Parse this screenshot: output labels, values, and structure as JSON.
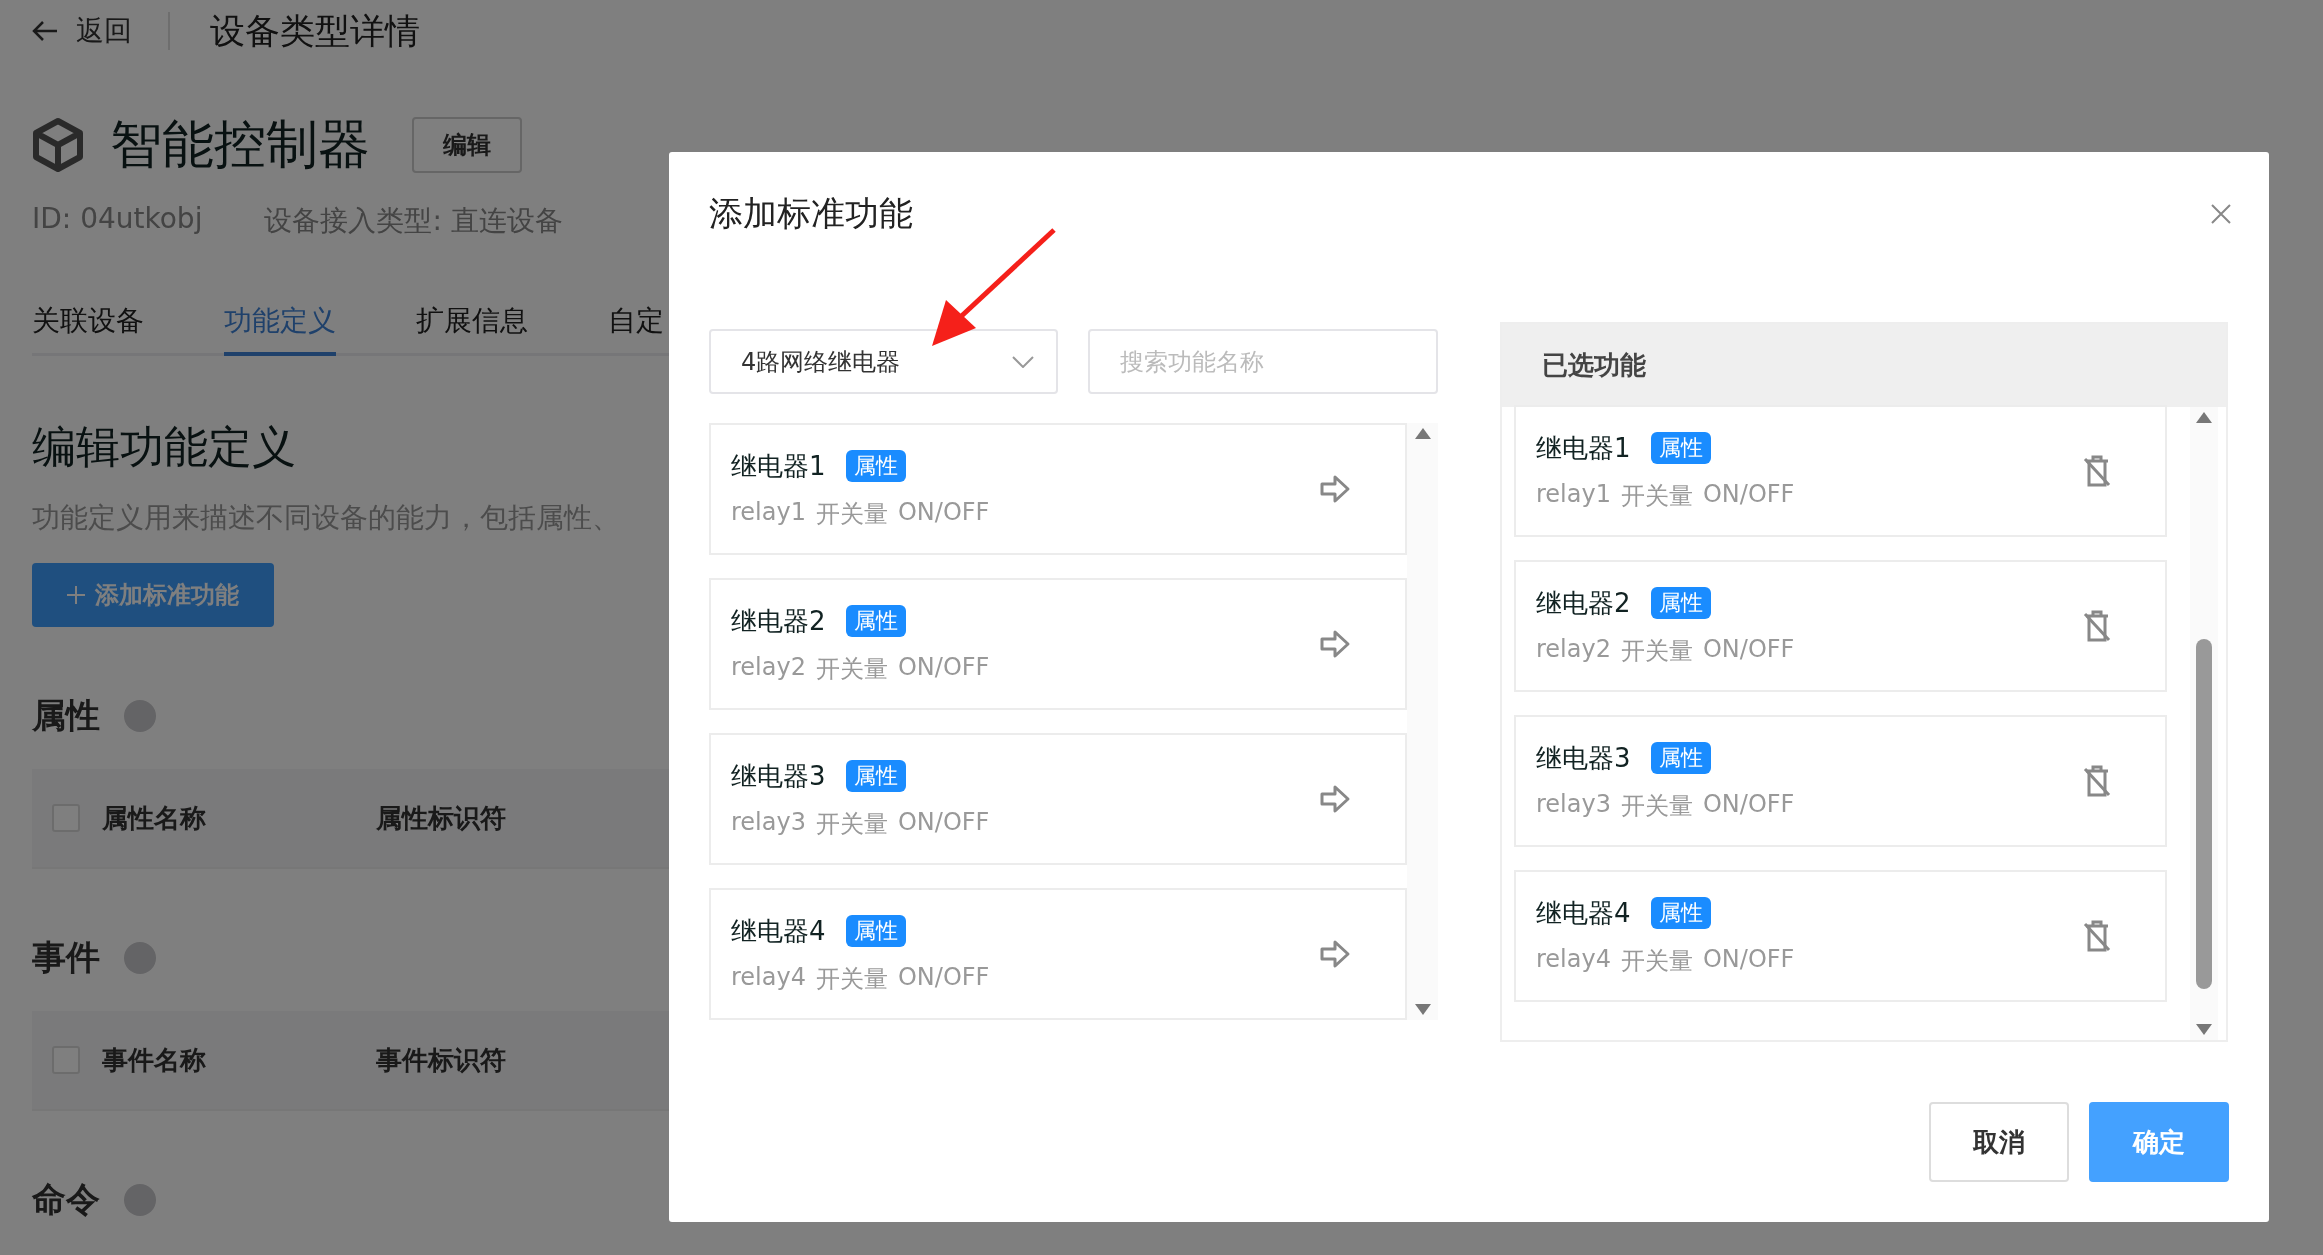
{
  "page": {
    "back": {
      "label": "返回"
    },
    "title": "设备类型详情",
    "device": {
      "name": "智能控制器",
      "edit_button": "编辑",
      "id": "ID: 04utkobj",
      "access_type": "设备接入类型: 直连设备"
    },
    "tabs": [
      {
        "label": "关联设备",
        "selected": false
      },
      {
        "label": "功能定义",
        "selected": true
      },
      {
        "label": "扩展信息",
        "selected": false
      },
      {
        "label": "自定",
        "selected": false
      }
    ],
    "section": {
      "title": "编辑功能定义",
      "description": "功能定义用来描述不同设备的能力，包括属性、",
      "add_button": "添加标准功能"
    },
    "groups": [
      {
        "title": "属性",
        "select_all": {
          "checked": false
        },
        "columns": [
          "属性名称",
          "属性标识符"
        ]
      },
      {
        "title": "事件",
        "select_all": {
          "checked": false
        },
        "columns": [
          "事件名称",
          "事件标识符"
        ]
      },
      {
        "title": "命令"
      }
    ]
  },
  "dialog": {
    "title": "添加标准功能",
    "template_select": {
      "value": "4路网络继电器"
    },
    "search": {
      "placeholder": "搜索功能名称"
    },
    "available": [
      {
        "name": "继电器1",
        "tag": "属性",
        "identifier": "relay1",
        "data_type": "开关量",
        "range": "ON/OFF"
      },
      {
        "name": "继电器2",
        "tag": "属性",
        "identifier": "relay2",
        "data_type": "开关量",
        "range": "ON/OFF"
      },
      {
        "name": "继电器3",
        "tag": "属性",
        "identifier": "relay3",
        "data_type": "开关量",
        "range": "ON/OFF"
      },
      {
        "name": "继电器4",
        "tag": "属性",
        "identifier": "relay4",
        "data_type": "开关量",
        "range": "ON/OFF"
      }
    ],
    "selected_panel": {
      "title": "已选功能",
      "items": [
        {
          "name": "继电器1",
          "tag": "属性",
          "identifier": "relay1",
          "data_type": "开关量",
          "range": "ON/OFF"
        },
        {
          "name": "继电器2",
          "tag": "属性",
          "identifier": "relay2",
          "data_type": "开关量",
          "range": "ON/OFF"
        },
        {
          "name": "继电器3",
          "tag": "属性",
          "identifier": "relay3",
          "data_type": "开关量",
          "range": "ON/OFF"
        },
        {
          "name": "继电器4",
          "tag": "属性",
          "identifier": "relay4",
          "data_type": "开关量",
          "range": "ON/OFF"
        }
      ]
    },
    "buttons": [
      {
        "label": "取消",
        "kind": "default"
      },
      {
        "label": "确定",
        "kind": "primary"
      }
    ]
  }
}
